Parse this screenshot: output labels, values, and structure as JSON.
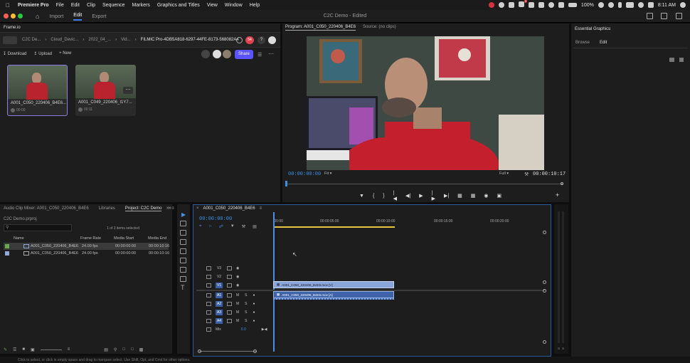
{
  "menubar": {
    "app_name": "Premiere Pro",
    "items": [
      "File",
      "Edit",
      "Clip",
      "Sequence",
      "Markers",
      "Graphics and Titles",
      "View",
      "Window",
      "Help"
    ],
    "badge_count": "3",
    "zoom": "100%",
    "clock": "8:11 AM"
  },
  "app_header": {
    "workspaces": [
      "Import",
      "Edit",
      "Export"
    ],
    "active_workspace": "Edit",
    "title": "C2C Demo - Edited"
  },
  "frameio": {
    "panel_title": "Frame.io",
    "breadcrumb": [
      "C2C De...",
      "Cloud_Devic...",
      "2022_04_...",
      "Vid...",
      "FILMIC Pro-4DB5A818-6297-44FE-8173-568082A4"
    ],
    "notif_count": "54",
    "help_label": "?",
    "actions": [
      "Download",
      "Upload",
      "New"
    ],
    "share_label": "Share",
    "clips": [
      {
        "name": "A001_C050_220406_B4E6...",
        "duration": "00:00"
      },
      {
        "name": "A001_C049_220406_I1Y7...",
        "duration": "00:11"
      }
    ]
  },
  "program": {
    "tabs": [
      "Program: A001_C050_220406_B4E6",
      "Source: (no clips)"
    ],
    "timecode": "00:00:00:00",
    "fit": "Fit",
    "quality": "Full",
    "duration": "00:00:10:17"
  },
  "essential": {
    "title": "Essential Graphics",
    "tabs": [
      "Browse",
      "Edit"
    ],
    "active_tab": "Edit"
  },
  "project_panel": {
    "tabs": [
      "Audio Clip Mixer: A001_C050_220406_B4E6",
      "Libraries",
      "Project: C2C Demo"
    ],
    "file": "C2C Demo.prproj",
    "selection": "1 of 3 items selected",
    "columns": [
      "Name",
      "Frame Rate",
      "Media Start",
      "Media End"
    ],
    "rows": [
      {
        "name": "A001_C050_220406_B4E6",
        "fps": "24.00 fps",
        "start": "00:00:00:00",
        "end": "00:00:10:16",
        "color": "#6aa84f"
      },
      {
        "name": "A001_C050_220406_B4E6",
        "fps": "24.00 fps",
        "start": "00:00:00:00",
        "end": "00:00:10:16",
        "color": "#8fa8d8"
      }
    ]
  },
  "timeline": {
    "tab": "A001_C050_220406_B4E6",
    "timecode": "00:00:00:00",
    "ruler": [
      ":00:00",
      "00:00:05:00",
      "00:00:10:00",
      "00:00:15:00",
      "00:00:20:00"
    ],
    "video_tracks": [
      "V3",
      "V2",
      "V1"
    ],
    "audio_tracks": [
      "A1",
      "A2",
      "A3",
      "A4"
    ],
    "mix_label": "Mix",
    "mix_value": "0.0",
    "video_clip": "A001_C050_220406_B4E6.mov [V]",
    "audio_clip": "A001_C050_220406_B4E6.mov [A]",
    "mute_label": "M",
    "solo_label": "S"
  },
  "meter": {
    "labels": [
      "S",
      "S"
    ]
  },
  "status_text": "Click to select, or click in empty space and drag to marquee select. Use Shift, Opt, and Cmd for other options."
}
